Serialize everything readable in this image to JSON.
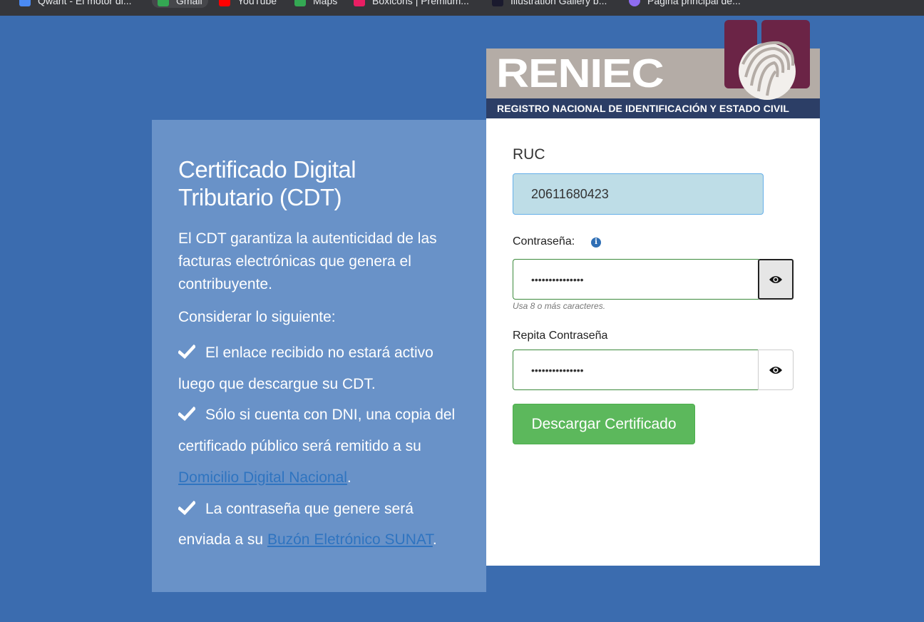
{
  "bookmarks": [
    {
      "label": "Qwant - El motor di...",
      "color": "#4a8af4"
    },
    {
      "label": "Gmail",
      "color": "#34a853"
    },
    {
      "label": "YouTube",
      "color": "#ff0000"
    },
    {
      "label": "Maps",
      "color": "#34a853"
    },
    {
      "label": "Boxicons | Premium...",
      "color": "#e91e63"
    },
    {
      "label": "Illustration Gallery b...",
      "color": "#1a1a2e"
    },
    {
      "label": "Página principal de...",
      "color": "#8e6cf0"
    }
  ],
  "info": {
    "title": "Certificado Digital Tributario (CDT)",
    "description": "El CDT garantiza la autenticidad de las facturas electrónicas que genera el contribuyente.",
    "consider": "Considerar lo siguiente:",
    "bullet1": "El enlace recibido no estará activo luego que descargue su CDT.",
    "bullet2_pre": "Sólo si cuenta con DNI, una copia del certificado público será remitido a su ",
    "bullet2_link": "Domicilio Digital Nacional",
    "bullet2_post": ".",
    "bullet3_pre": "La contraseña que genere será enviada a su ",
    "bullet3_link": "Buzón Eletrónico SUNAT",
    "bullet3_post": "."
  },
  "logo": {
    "brand": "RENIEC",
    "subtitle": "REGISTRO NACIONAL DE IDENTIFICACIÓN Y ESTADO CIVIL"
  },
  "form": {
    "ruc_label": "RUC",
    "ruc_value": "20611680423",
    "password_label": "Contraseña:",
    "password_value": "•••••••••••••••",
    "password_hint": "Usa 8 o más caracteres.",
    "repeat_label": "Repita Contraseña",
    "repeat_value": "•••••••••••••••",
    "submit_label": "Descargar Certificado"
  },
  "colors": {
    "background": "#3b6caf",
    "panel": "#6992c8",
    "success_button": "#5cb85c",
    "link": "#2f74c0"
  }
}
